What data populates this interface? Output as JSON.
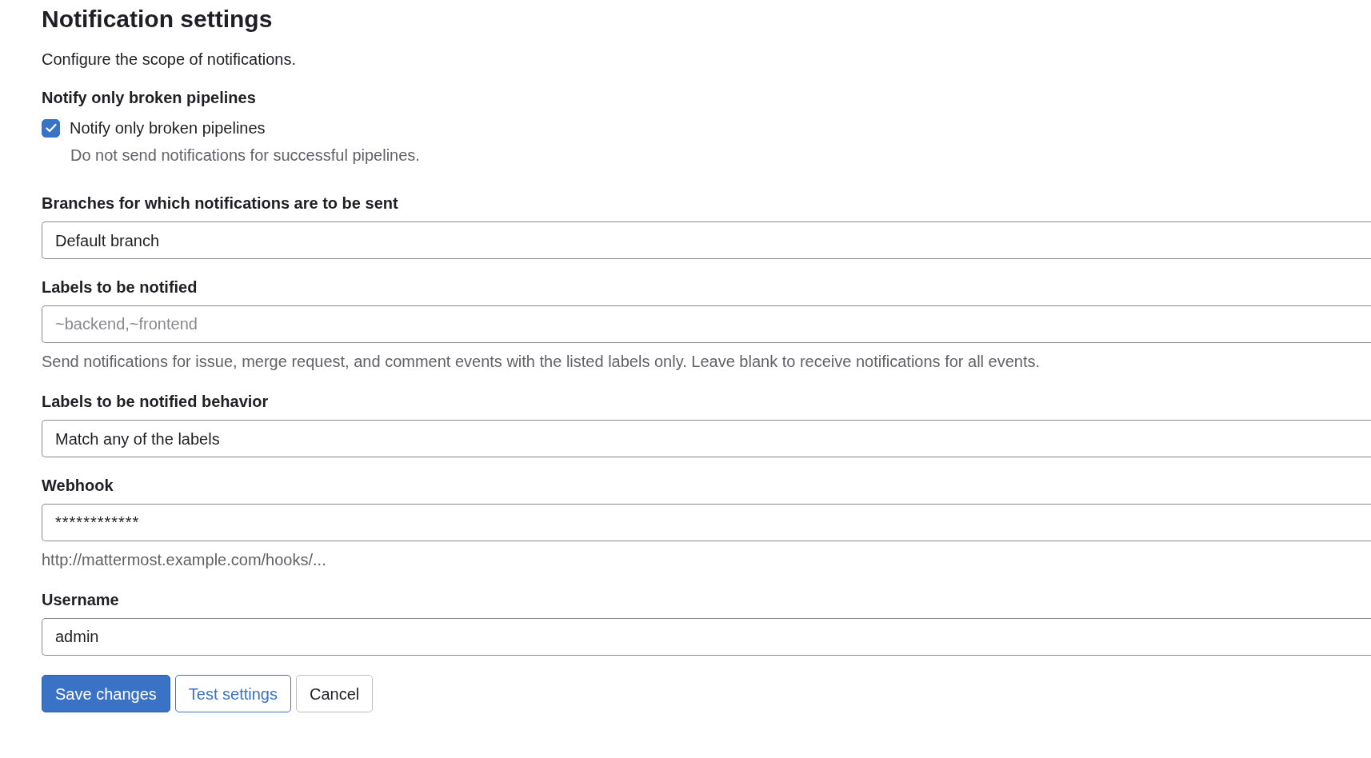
{
  "title": "Notification settings",
  "description": "Configure the scope of notifications.",
  "notify_section": {
    "label": "Notify only broken pipelines",
    "checkbox": {
      "label": "Notify only broken pipelines",
      "checked": true,
      "help": "Do not send notifications for successful pipelines."
    }
  },
  "fields": [
    {
      "kind": "select",
      "label": "Branches for which notifications are to be sent",
      "value": "Default branch"
    },
    {
      "kind": "text",
      "label": "Labels to be notified",
      "placeholder": "~backend,~frontend",
      "help": "Send notifications for issue, merge request, and comment events with the listed labels only. Leave blank to receive notifications for all events."
    },
    {
      "kind": "select",
      "label": "Labels to be notified behavior",
      "value": "Match any of the labels"
    },
    {
      "kind": "password",
      "label": "Webhook",
      "value": "************",
      "help": "http://mattermost.example.com/hooks/..."
    },
    {
      "kind": "text",
      "label": "Username",
      "value": "admin"
    }
  ],
  "buttons": [
    {
      "kind": "primary",
      "label": "Save changes"
    },
    {
      "kind": "outline",
      "label": "Test settings"
    },
    {
      "kind": "plain",
      "label": "Cancel"
    }
  ]
}
